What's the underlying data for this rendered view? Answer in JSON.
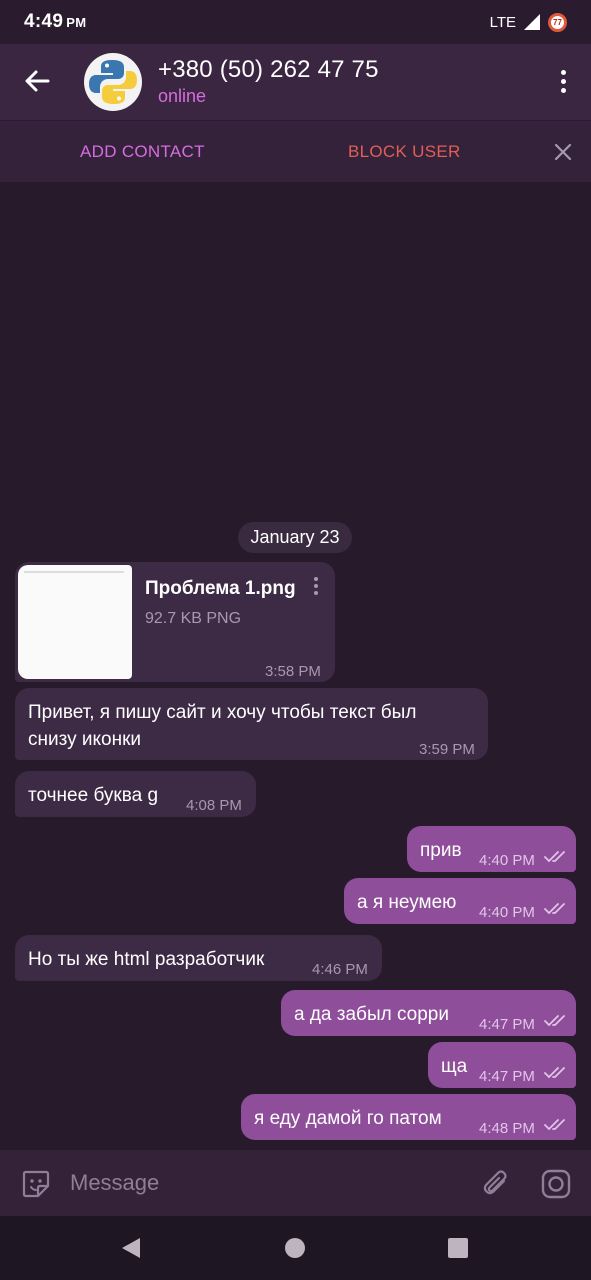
{
  "status_bar": {
    "time": "4:49",
    "ampm": "PM",
    "network": "LTE",
    "battery": "77"
  },
  "header": {
    "title": "+380 (50) 262 47 75",
    "status": "online"
  },
  "actions": {
    "add_contact": "ADD CONTACT",
    "block_user": "BLOCK USER"
  },
  "chat": {
    "date": "January 23",
    "file": {
      "name": "Проблема 1.png",
      "size": "92.7 KB PNG",
      "time": "3:58 PM"
    },
    "messages": [
      {
        "line1": "Привет, я пишу сайт и хочу чтобы текст был",
        "line2": "снизу иконки",
        "time": "3:59 PM"
      },
      {
        "text": "точнее буква g",
        "time": "4:08 PM"
      },
      {
        "text": "прив",
        "time": "4:40 PM"
      },
      {
        "text": "а я неумею",
        "time": "4:40 PM"
      },
      {
        "text": "Но ты же html разработчик",
        "time": "4:46 PM"
      },
      {
        "text": "а да забыл сорри",
        "time": "4:47 PM"
      },
      {
        "text": "ща",
        "time": "4:47 PM"
      },
      {
        "text": "я еду дамой го патом",
        "time": "4:48 PM"
      }
    ]
  },
  "input": {
    "placeholder": "Message"
  },
  "colors": {
    "accent": "#d66ce0",
    "danger": "#e05f57",
    "outgoing_bubble": "#8e4e9a",
    "incoming_bubble": "#3d2a45",
    "background": "#261a2b"
  },
  "icons": [
    "arrow-left-icon",
    "python-logo-avatar",
    "more-vertical-icon",
    "close-icon",
    "sticker-icon",
    "paperclip-icon",
    "camera-icon",
    "double-check-icon",
    "nav-back-icon",
    "nav-home-icon",
    "nav-recents-icon"
  ]
}
